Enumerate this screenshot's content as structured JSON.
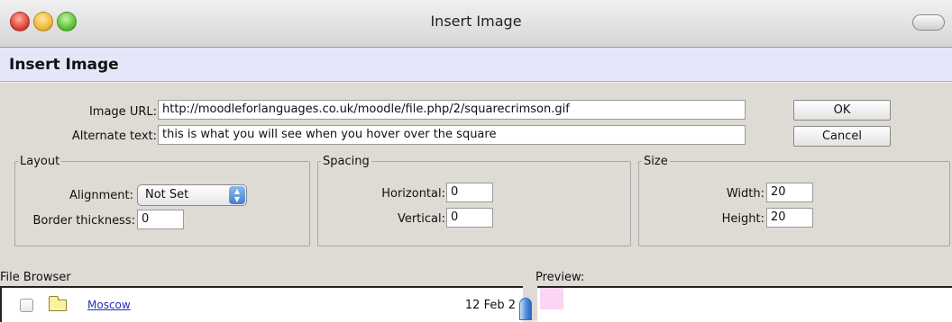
{
  "window": {
    "title": "Insert Image"
  },
  "header": {
    "title": "Insert Image"
  },
  "form": {
    "image_url_label": "Image URL:",
    "image_url_value": "http://moodleforlanguages.co.uk/moodle/file.php/2/squarecrimson.gif",
    "alt_text_label": "Alternate text:",
    "alt_text_value": "this is what you will see when you hover over the square"
  },
  "buttons": {
    "ok": "OK",
    "cancel": "Cancel"
  },
  "layout_group": {
    "legend": "Layout",
    "alignment_label": "Alignment:",
    "alignment_value": "Not Set",
    "border_label": "Border thickness:",
    "border_value": "0"
  },
  "spacing_group": {
    "legend": "Spacing",
    "horizontal_label": "Horizontal:",
    "horizontal_value": "0",
    "vertical_label": "Vertical:",
    "vertical_value": "0"
  },
  "size_group": {
    "legend": "Size",
    "width_label": "Width:",
    "width_value": "20",
    "height_label": "Height:",
    "height_value": "20"
  },
  "file_browser": {
    "label": "File Browser",
    "items": [
      {
        "name": "Moscow",
        "date": "12 Feb 2"
      }
    ]
  },
  "preview": {
    "label": "Preview:",
    "swatch_color": "#fbd5f3"
  },
  "colors": {
    "header_bg": "#e6e6fa",
    "link": "#1f2fb8",
    "panel_bg": "#dedbd4"
  }
}
